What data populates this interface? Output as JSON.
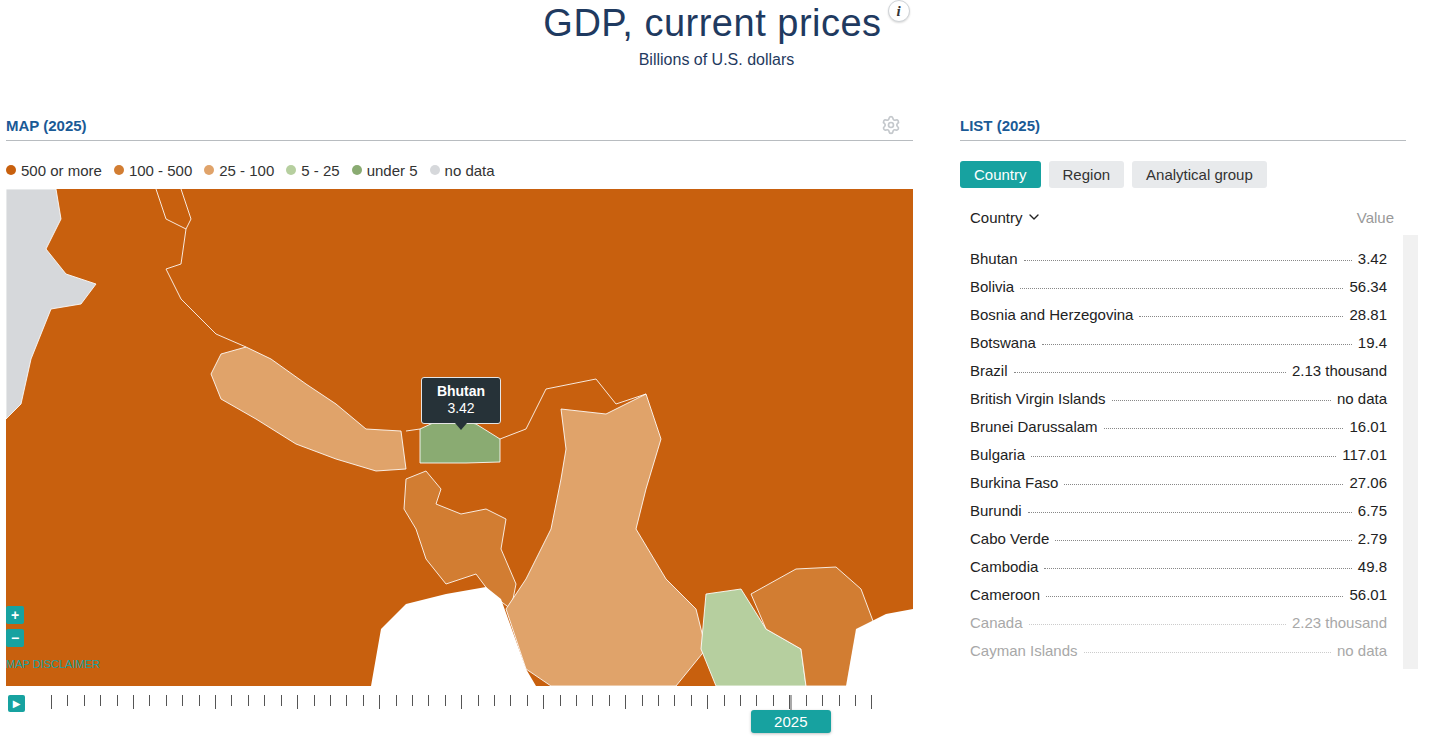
{
  "page": {
    "title": "GDP, current prices",
    "info": "i",
    "subtitle": "Billions of U.S. dollars"
  },
  "map_panel": {
    "heading": "MAP (2025)",
    "legend": [
      {
        "label": "500 or more",
        "color": "#c8600e"
      },
      {
        "label": "100 - 500",
        "color": "#d27d32"
      },
      {
        "label": "25 - 100",
        "color": "#e0a36a"
      },
      {
        "label": "5 - 25",
        "color": "#b6cf9f"
      },
      {
        "label": "under 5",
        "color": "#8aab72"
      },
      {
        "label": "no data",
        "color": "#d6d8db"
      }
    ],
    "regions": [
      {
        "band": "500 or more"
      },
      {
        "band": "no data"
      },
      {
        "band": "25 - 100"
      },
      {
        "band": "under 5"
      },
      {
        "band": "100 - 500"
      },
      {
        "band": "25 - 100"
      },
      {
        "band": "5 - 25"
      },
      {
        "band": "100 - 500"
      }
    ],
    "tooltip": {
      "name": "Bhutan",
      "value": "3.42"
    },
    "zoom": [
      "+",
      "−"
    ],
    "disclaimer": "MAP DISCLAIMER",
    "timeline": {
      "play": "▶",
      "year": "2025",
      "level": 0.9
    }
  },
  "list_panel": {
    "heading": "LIST (2025)",
    "tabs": [
      {
        "label": "Country",
        "selected": true
      },
      {
        "label": "Region",
        "selected": false
      },
      {
        "label": "Analytical group",
        "selected": false
      }
    ],
    "columns": [
      "Country",
      "Value"
    ],
    "rows": [
      {
        "name": "Bhutan",
        "value": "3.42",
        "faded": false
      },
      {
        "name": "Bolivia",
        "value": "56.34",
        "faded": false
      },
      {
        "name": "Bosnia and Herzegovina",
        "value": "28.81",
        "faded": false
      },
      {
        "name": "Botswana",
        "value": "19.4",
        "faded": false
      },
      {
        "name": "Brazil",
        "value": "2.13 thousand",
        "faded": false
      },
      {
        "name": "British Virgin Islands",
        "value": "no data",
        "faded": false
      },
      {
        "name": "Brunei Darussalam",
        "value": "16.01",
        "faded": false
      },
      {
        "name": "Bulgaria",
        "value": "117.01",
        "faded": false
      },
      {
        "name": "Burkina Faso",
        "value": "27.06",
        "faded": false
      },
      {
        "name": "Burundi",
        "value": "6.75",
        "faded": false
      },
      {
        "name": "Cabo Verde",
        "value": "2.79",
        "faded": false
      },
      {
        "name": "Cambodia",
        "value": "49.8",
        "faded": false
      },
      {
        "name": "Cameroon",
        "value": "56.01",
        "faded": false
      },
      {
        "name": "Canada",
        "value": "2.23 thousand",
        "faded": true
      },
      {
        "name": "Cayman Islands",
        "value": "no data",
        "faded": true
      }
    ]
  }
}
